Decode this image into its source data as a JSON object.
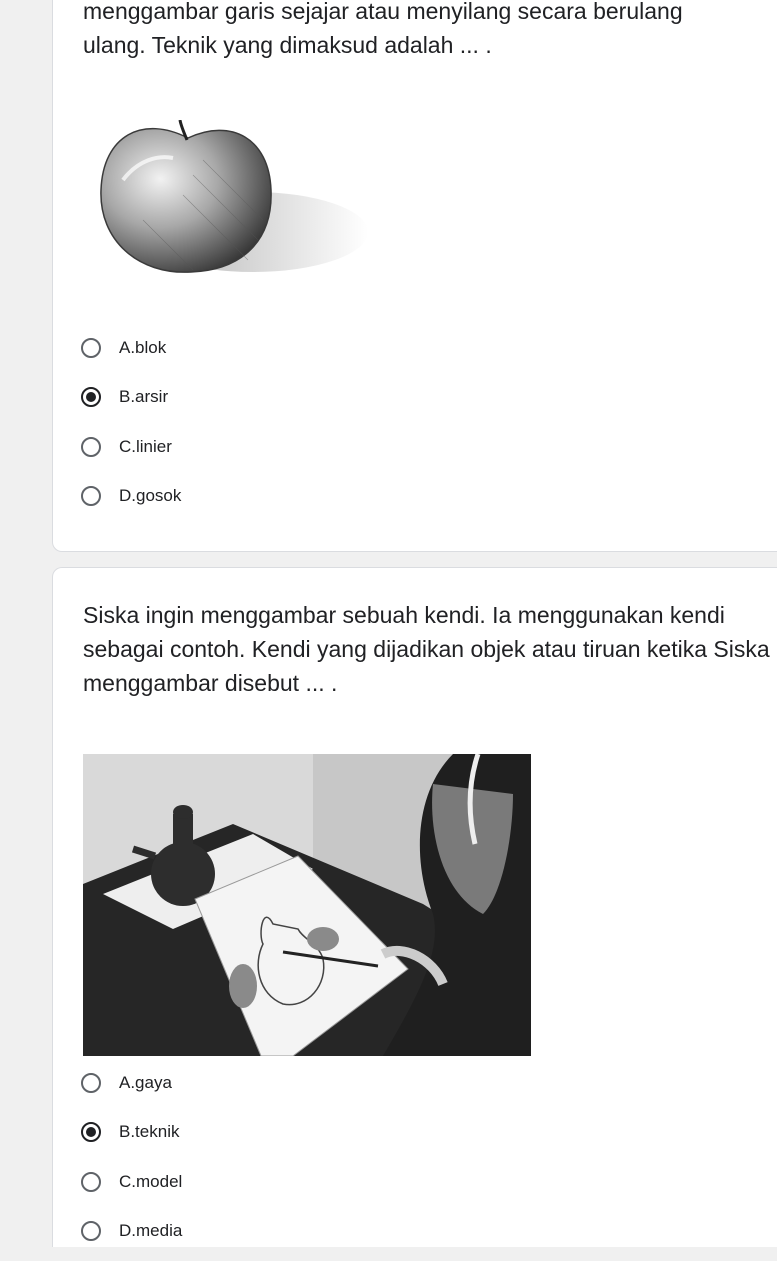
{
  "questions": [
    {
      "text_lines": [
        "menggambar garis sejajar atau menyilang secara berulang",
        "ulang. Teknik yang dimaksud adalah ... ."
      ],
      "image_icon": "apple-pencil-drawing",
      "options": [
        "A.blok",
        "B.arsir",
        "C.linier",
        "D.gosok"
      ],
      "selected_index": 1
    },
    {
      "text": "Siska ingin menggambar sebuah kendi. Ia menggunakan kendi sebagai contoh. Kendi yang dijadikan objek atau tiruan ketika Siska menggambar disebut ... .",
      "image_icon": "girl-drawing-jug-photo",
      "options": [
        "A.gaya",
        "B.teknik",
        "C.model",
        "D.media"
      ],
      "selected_index": 1
    }
  ],
  "colors": {
    "page_background": "#f0f0f0",
    "card_background": "#ffffff",
    "card_border": "#dadce0",
    "text": "#202124",
    "radio_unchecked": "#5f6368"
  }
}
